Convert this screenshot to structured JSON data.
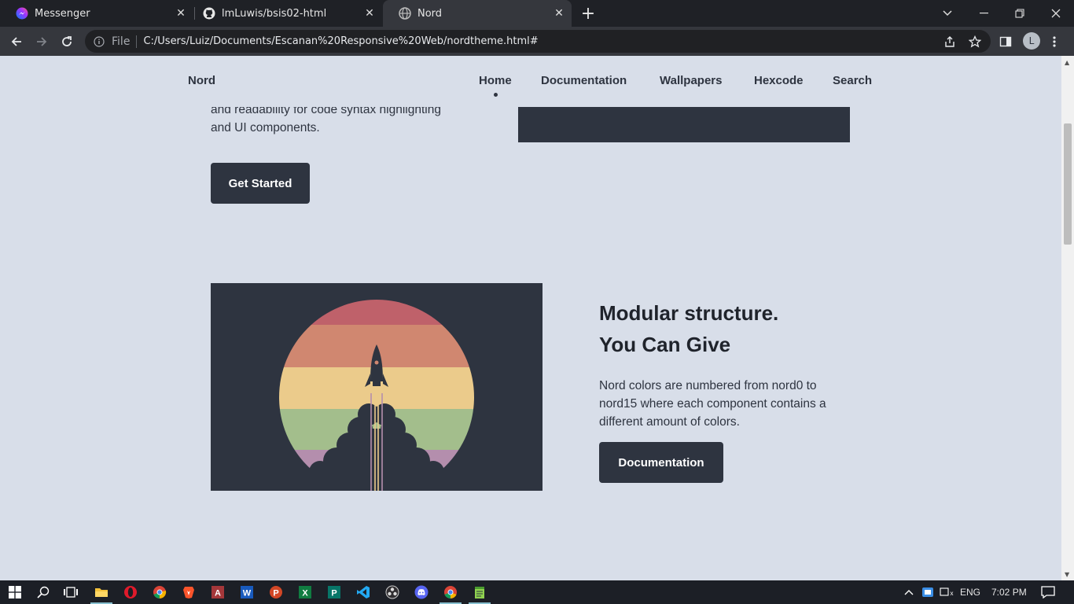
{
  "browser": {
    "tabs": [
      {
        "title": "Messenger",
        "icon": "messenger-icon",
        "active": false
      },
      {
        "title": "lmLuwis/bsis02-html",
        "icon": "github-icon",
        "active": false
      },
      {
        "title": "Nord",
        "icon": "globe-icon",
        "active": true
      }
    ],
    "address": {
      "scheme_label": "File",
      "url": "C:/Users/Luiz/Documents/Escanan%20Responsive%20Web/nordtheme.html#"
    },
    "profile_initial": "L"
  },
  "site": {
    "brand": "Nord",
    "nav": [
      {
        "label": "Home",
        "active": true
      },
      {
        "label": "Documentation",
        "active": false
      },
      {
        "label": "Wallpapers",
        "active": false
      },
      {
        "label": "Hexcode",
        "active": false
      },
      {
        "label": "Search",
        "active": false
      }
    ],
    "hero": {
      "text_line1": "and readability for code syntax highlighting",
      "text_line2": "and UI components.",
      "cta": "Get Started"
    },
    "feature": {
      "title_line1": "Modular structure.",
      "title_line2": "You Can Give",
      "description": "Nord colors are numbered from nord0 to nord15 where each component contains a different amount of colors.",
      "cta": "Documentation"
    }
  },
  "taskbar": {
    "language": "ENG",
    "time": "7:02 PM"
  },
  "colors": {
    "page_bg": "#d8dee9",
    "dark": "#2e3440",
    "aurora_red": "#bf616a",
    "aurora_orange": "#d08770",
    "aurora_yellow": "#ebcb8b",
    "aurora_green": "#a3be8c",
    "aurora_purple": "#b48ead"
  }
}
